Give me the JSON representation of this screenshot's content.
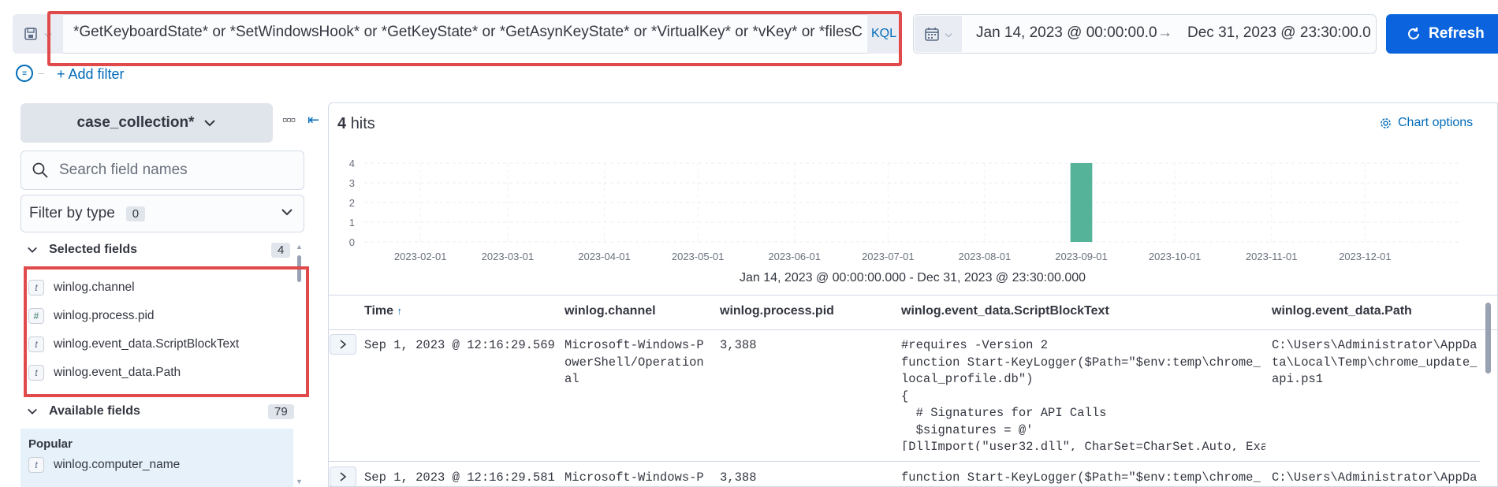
{
  "query_bar": {
    "query": "*GetKeyboardState* or *SetWindowsHook* or *GetKeyState* or *GetAsynKeyState* or *VirtualKey* or *vKey* or *filesCre",
    "language": "KQL"
  },
  "date_picker": {
    "start": "Jan 14, 2023 @ 00:00:00.0",
    "arrow": "→",
    "end": "Dec 31, 2023 @ 23:30:00.0"
  },
  "refresh_label": "Refresh",
  "add_filter_label": "+ Add filter",
  "sidebar": {
    "index_pattern": "case_collection*",
    "search_placeholder": "Search field names",
    "filter_by_type": {
      "label": "Filter by type",
      "count": "0"
    },
    "selected_fields": {
      "label": "Selected fields",
      "count": "4",
      "items": [
        {
          "type": "t",
          "name": "winlog.channel"
        },
        {
          "type": "#",
          "name": "winlog.process.pid"
        },
        {
          "type": "t",
          "name": "winlog.event_data.ScriptBlockText"
        },
        {
          "type": "t",
          "name": "winlog.event_data.Path"
        }
      ]
    },
    "available_fields": {
      "label": "Available fields",
      "count": "79",
      "popular_label": "Popular",
      "popular_items": [
        {
          "type": "t",
          "name": "winlog.computer_name"
        }
      ]
    }
  },
  "main": {
    "hits_count": "4",
    "hits_label": "hits",
    "chart_options_label": "Chart options",
    "time_range_label": "Jan 14, 2023 @ 00:00:00.000 - Dec 31, 2023 @ 23:30:00.000"
  },
  "chart_data": {
    "type": "bar",
    "y_ticks": [
      "0",
      "1",
      "2",
      "3",
      "4"
    ],
    "ylim": [
      0,
      4
    ],
    "x_ticks": [
      "2023-02-01",
      "2023-03-01",
      "2023-04-01",
      "2023-05-01",
      "2023-06-01",
      "2023-07-01",
      "2023-08-01",
      "2023-09-01",
      "2023-10-01",
      "2023-11-01",
      "2023-12-01"
    ],
    "x_range": [
      "2023-01-14",
      "2023-12-31"
    ],
    "bars": [
      {
        "x": "2023-09-01",
        "value": 4
      }
    ],
    "bar_color": "#54b399",
    "grid": true
  },
  "table": {
    "columns": [
      "Time",
      "winlog.channel",
      "winlog.process.pid",
      "winlog.event_data.ScriptBlockText",
      "winlog.event_data.Path"
    ],
    "rows": [
      {
        "time": "Sep 1, 2023 @ 12:16:29.569",
        "channel": "Microsoft-Windows-P\nowerShell/Operation\nal",
        "pid": "3,388",
        "script": "#requires -Version 2\nfunction Start-KeyLogger($Path=\"$env:temp\\chrome_\nlocal_profile.db\")\n{\n  # Signatures for API Calls\n  $signatures = @'\n[DllImport(\"user32.dll\", CharSet=CharSet.Auto, Exa",
        "path": "C:\\Users\\Administrator\\AppDa\nta\\Local\\Temp\\chrome_update_\napi.ps1"
      },
      {
        "time": "Sep 1, 2023 @ 12:16:29.581",
        "channel": "Microsoft-Windows-P",
        "pid": "3,388",
        "script": "function Start-KeyLogger($Path=\"$env:temp\\chrome_",
        "path": "C:\\Users\\Administrator\\AppDa"
      }
    ]
  }
}
